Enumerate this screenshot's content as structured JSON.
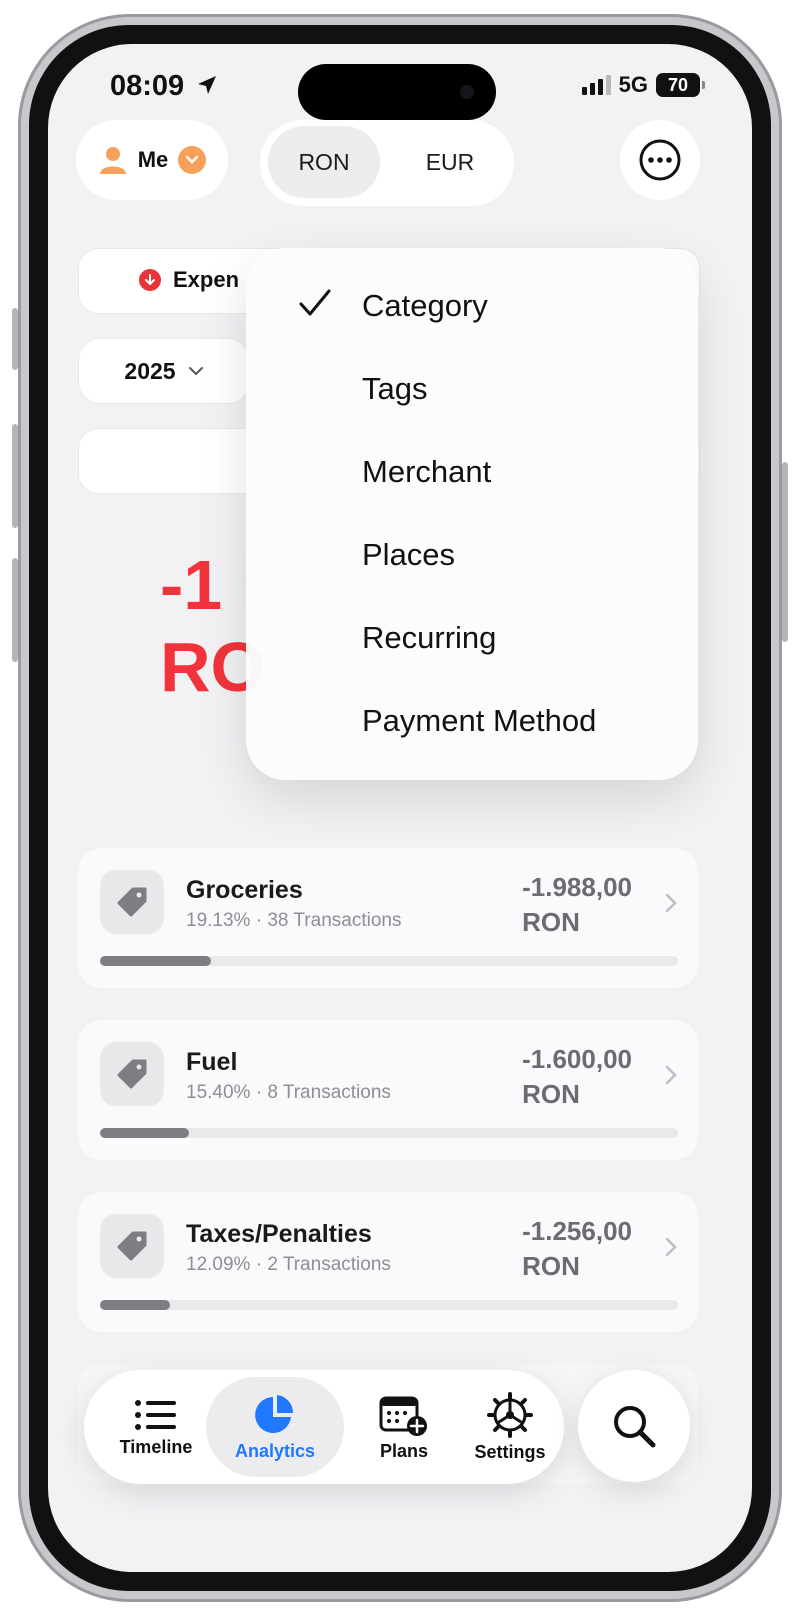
{
  "status": {
    "time": "08:09",
    "network": "5G",
    "battery": "70"
  },
  "header": {
    "user_label": "Me",
    "currencies": [
      "RON",
      "EUR"
    ],
    "selected_currency": "RON"
  },
  "filters": {
    "type_label": "Expen",
    "year": "2025"
  },
  "summary": {
    "total_line1": "-1",
    "total_line2": "RO"
  },
  "group_menu": {
    "items": [
      "Category",
      "Tags",
      "Merchant",
      "Places",
      "Recurring",
      "Payment Method"
    ],
    "selected": "Category"
  },
  "categories": [
    {
      "name": "Groceries",
      "detail": "19.13% · 38 Transactions",
      "amount_value": "-1.988,00",
      "amount_currency": "RON",
      "share": 0.1913
    },
    {
      "name": "Fuel",
      "detail": "15.40% · 8 Transactions",
      "amount_value": "-1.600,00",
      "amount_currency": "RON",
      "share": 0.154
    },
    {
      "name": "Taxes/Penalties",
      "detail": "12.09% · 2 Transactions",
      "amount_value": "-1.256,00",
      "amount_currency": "RON",
      "share": 0.1209
    }
  ],
  "tabbar": {
    "tabs": [
      {
        "label": "Timeline",
        "icon": "list-icon"
      },
      {
        "label": "Analytics",
        "icon": "pie-chart-icon"
      },
      {
        "label": "Plans",
        "icon": "calendar-plus-icon"
      },
      {
        "label": "Settings",
        "icon": "gear-icon"
      }
    ],
    "active": "Analytics",
    "search_icon": "magnifier-icon"
  },
  "colors": {
    "accent": "#1f78ff",
    "expense_red": "#f2333b",
    "avatar_orange": "#f5a15c"
  }
}
